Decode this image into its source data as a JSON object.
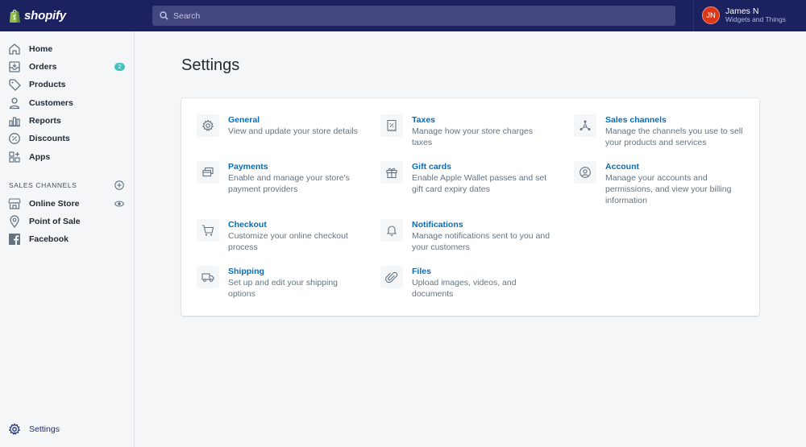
{
  "topbar": {
    "brand": "shopify",
    "search_placeholder": "Search",
    "user": {
      "initials": "JN",
      "name": "James N",
      "store": "Widgets and Things"
    }
  },
  "sidebar": {
    "items": [
      {
        "label": "Home",
        "icon": "home-icon"
      },
      {
        "label": "Orders",
        "icon": "orders-icon",
        "badge": "2"
      },
      {
        "label": "Products",
        "icon": "tag-icon"
      },
      {
        "label": "Customers",
        "icon": "person-icon"
      },
      {
        "label": "Reports",
        "icon": "bar-chart-icon"
      },
      {
        "label": "Discounts",
        "icon": "discount-icon"
      },
      {
        "label": "Apps",
        "icon": "apps-icon"
      }
    ],
    "sales_channels_title": "SALES CHANNELS",
    "channels": [
      {
        "label": "Online Store",
        "icon": "store-icon"
      },
      {
        "label": "Point of Sale",
        "icon": "location-pin-icon"
      },
      {
        "label": "Facebook",
        "icon": "facebook-icon"
      }
    ],
    "settings_label": "Settings"
  },
  "main": {
    "title": "Settings",
    "settings": [
      {
        "title": "General",
        "desc_lines": [
          "View and update your store details"
        ],
        "icon": "gear-icon"
      },
      {
        "title": "Taxes",
        "desc_lines": [
          "Manage how your store charges",
          "taxes"
        ],
        "icon": "receipt-icon"
      },
      {
        "title": "Sales channels",
        "desc_lines": [
          "Manage the channels you use to sell",
          "your products and services"
        ],
        "icon": "channels-icon"
      },
      {
        "title": "Payments",
        "desc_lines": [
          "Enable and manage your store's",
          "payment providers"
        ],
        "icon": "credit-card-icon"
      },
      {
        "title": "Gift cards",
        "desc_lines": [
          "Enable Apple Wallet passes and set",
          "gift card expiry dates"
        ],
        "icon": "gift-icon"
      },
      {
        "title": "Account",
        "desc_lines": [
          "Manage your accounts and",
          "permissions, and view your billing",
          "information"
        ],
        "icon": "account-icon"
      },
      {
        "title": "Checkout",
        "desc_lines": [
          "Customize your online checkout",
          "process"
        ],
        "icon": "cart-icon"
      },
      {
        "title": "Notifications",
        "desc_lines": [
          "Manage notifications sent to you and",
          "your customers"
        ],
        "icon": "bell-icon"
      },
      {
        "title": "Shipping",
        "desc_lines": [
          "Set up and edit your shipping",
          "options"
        ],
        "icon": "truck-icon"
      },
      {
        "title": "Files",
        "desc_lines": [
          "Upload images, videos, and",
          "documents"
        ],
        "icon": "paperclip-icon"
      }
    ]
  },
  "colors": {
    "topbar": "#1c2260",
    "link": "#006fbb",
    "badge": "#47c1bf",
    "avatar": "#de3618"
  }
}
